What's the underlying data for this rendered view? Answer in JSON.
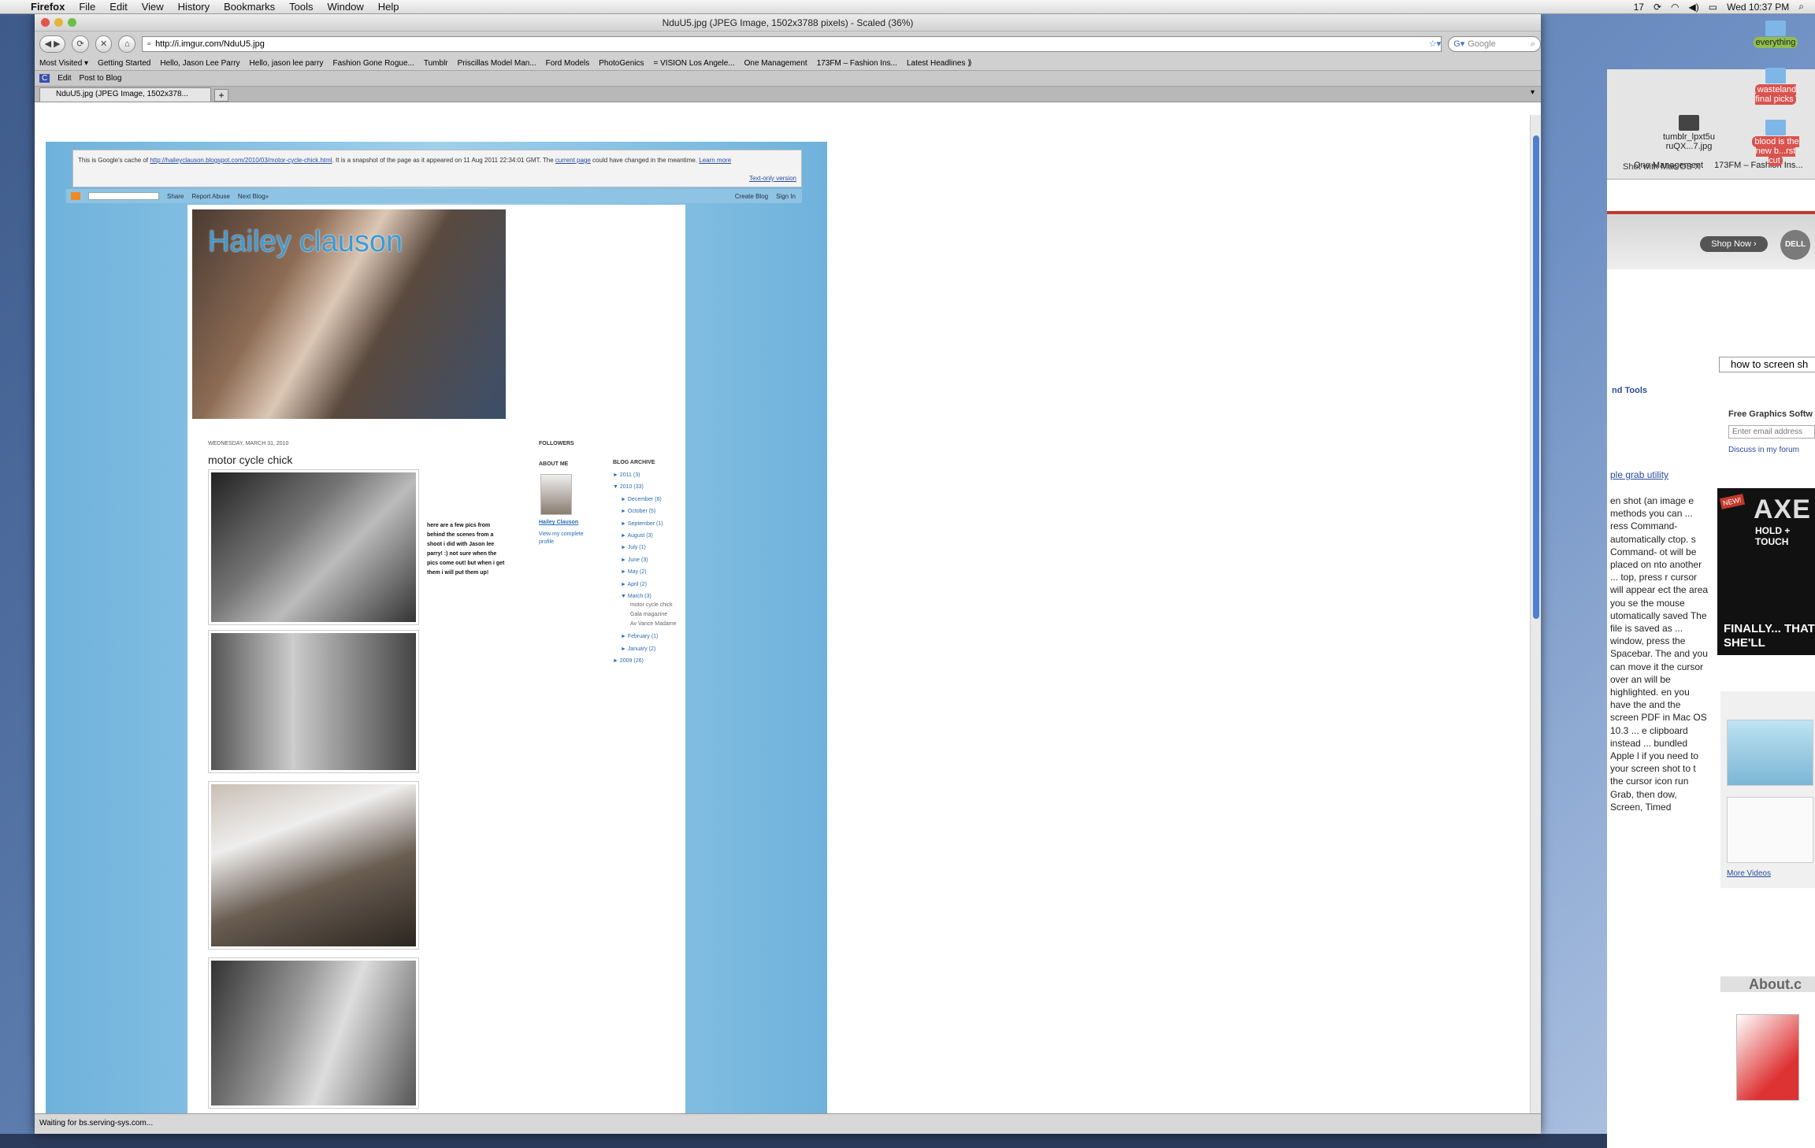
{
  "menubar": {
    "app": "Firefox",
    "items": [
      "File",
      "Edit",
      "View",
      "History",
      "Bookmarks",
      "Tools",
      "Window",
      "Help"
    ],
    "clock": "Wed 10:37 PM",
    "badge": "17"
  },
  "window": {
    "title": "NduU5.jpg (JPEG Image, 1502x3788 pixels) - Scaled (36%)"
  },
  "nav": {
    "url": "http://i.imgur.com/NduU5.jpg",
    "search_placeholder": "Google"
  },
  "bookmarks": [
    "Most Visited ▾",
    "Getting Started",
    "Hello, Jason Lee Parry",
    "Hello, jason lee parry",
    "Fashion Gone Rogue...",
    "Tumblr",
    "Priscillas Model Man...",
    "Ford Models",
    "PhotoGenics",
    "= VISION Los Angele...",
    "One Management",
    "173FM – Fashion Ins...",
    "Latest Headlines ⟫"
  ],
  "blogbar": {
    "edit": "Edit",
    "post": "Post to Blog"
  },
  "tab": {
    "label": "NduU5.jpg (JPEG Image, 1502x378..."
  },
  "status": "Waiting for bs.serving-sys.com...",
  "cache": {
    "pre": "This is Google's cache of ",
    "url": "http://haileyclauson.blogspot.com/2010/03/motor-cycle-chick.html",
    "mid": ". It is a snapshot of the page as it appeared on 11 Aug 2011 22:34:01 GMT. The ",
    "current": "current page",
    "post": " could have changed in the meantime. ",
    "learn": "Learn more",
    "textonly": "Text-only version"
  },
  "blognav": {
    "share": "Share",
    "report": "Report Abuse",
    "next": "Next Blog»",
    "create": "Create Blog",
    "signin": "Sign In"
  },
  "blog": {
    "title": "Hailey clauson",
    "date": "WEDNESDAY, MARCH 31, 2010",
    "post_title": "motor cycle chick",
    "post_text": "here are a few pics from behind the scenes from a shoot i did with Jason lee parry! :) not sure when the pics come out! but when i get them i will put them up!",
    "followers": "FOLLOWERS",
    "about": "ABOUT ME",
    "name": "Hailey Clauson",
    "view_profile": "View my complete profile",
    "archive_head": "BLOG ARCHIVE",
    "archive": [
      {
        "lvl": 0,
        "t": "► 2011 (3)"
      },
      {
        "lvl": 0,
        "t": "▼ 2010 (33)"
      },
      {
        "lvl": 1,
        "t": "► December (6)"
      },
      {
        "lvl": 1,
        "t": "► October (5)"
      },
      {
        "lvl": 1,
        "t": "► September (1)"
      },
      {
        "lvl": 1,
        "t": "► August (3)"
      },
      {
        "lvl": 1,
        "t": "► July (1)"
      },
      {
        "lvl": 1,
        "t": "► June (3)"
      },
      {
        "lvl": 1,
        "t": "► May (2)"
      },
      {
        "lvl": 1,
        "t": "► April (2)"
      },
      {
        "lvl": 1,
        "t": "▼ March (3)"
      },
      {
        "lvl": 2,
        "t": "motor cycle chick"
      },
      {
        "lvl": 2,
        "t": "Gala magazine"
      },
      {
        "lvl": 2,
        "t": "Av Vance Madame"
      },
      {
        "lvl": 1,
        "t": "► February (1)"
      },
      {
        "lvl": 1,
        "t": "► January (2)"
      },
      {
        "lvl": 0,
        "t": "► 2009 (26)"
      }
    ]
  },
  "backwin": {
    "menu1": "One Management",
    "menu2": "173FM – Fashion Ins...",
    "shop": "Shop Now ›",
    "dell": "DELL",
    "search": "how to screen sh",
    "tools": "nd Tools",
    "graphics": "Free Graphics Softw",
    "email": "Enter email address",
    "discuss": "Discuss in my forum",
    "grab": "ple grab utility",
    "screenshot_caption": "Shot with Mac OS X",
    "text": "en shot (an image e methods you can ... ress Command- automatically ctop. s Command- ot will be placed on nto another ... top, press r cursor will appear ect the area you se the mouse utomatically saved The file is saved as ... window, press the Spacebar. The and you can move it the cursor over an will be highlighted. en you have the and the screen PDF in Mac OS 10.3 ... e clipboard instead ... bundled Apple l if you need to your screen shot to t the cursor icon run Grab, then dow, Screen, Timed",
    "axe": "AXE",
    "axe2": "HOLD + TOUCH",
    "axe3": "FINALLY... THAT SHE'LL",
    "new": "NEW!",
    "more_videos": "More Videos",
    "about": "About.c"
  },
  "desktop": {
    "icons": [
      "everything",
      "wasteland final picks",
      "blood is the new b...rst cut",
      "tumblr_lpxt5u ruQX...7.jpg"
    ]
  }
}
